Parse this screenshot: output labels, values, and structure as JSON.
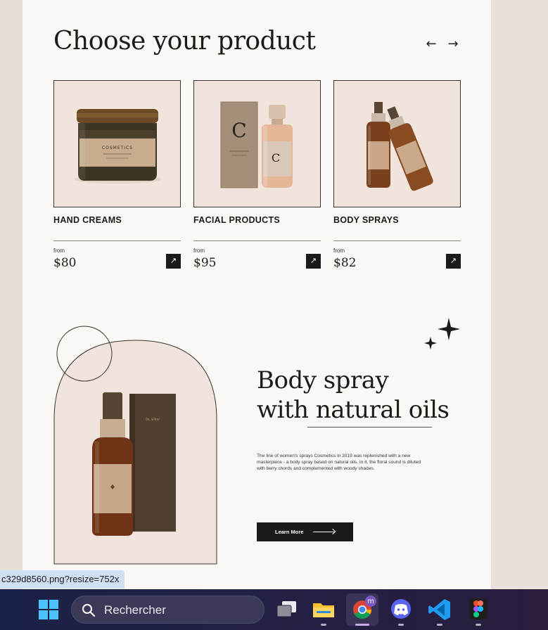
{
  "section": {
    "title": "Choose your product",
    "prev_icon": "←",
    "next_icon": "→"
  },
  "products": [
    {
      "name": "HAND CREAMS",
      "from": "from",
      "price": "$80",
      "icon": "arrow-up-right-icon"
    },
    {
      "name": "FACIAL PRODUCTS",
      "from": "from",
      "price": "$95",
      "icon": "arrow-up-right-icon"
    },
    {
      "name": "BODY SPRAYS",
      "from": "from",
      "price": "$82",
      "icon": "arrow-up-right-icon"
    }
  ],
  "feature": {
    "title": "Body spray\nwith natural oils",
    "text": "The line of women's sprays Cosmetics in 2019 was replenished with a new masterpiece - a body spray based on natural oils. In it, the floral sound is diluted with berry chords and complemented with woody shades.",
    "button_label": "Learn More"
  },
  "browser": {
    "status_url": "c329d8560.png?resize=752x"
  },
  "taskbar": {
    "search_placeholder": "Rechercher",
    "chrome_profile_badge": "m",
    "apps": [
      "start-icon",
      "search-icon",
      "task-view-icon",
      "file-explorer-icon",
      "chrome-icon",
      "discord-icon",
      "vscode-icon",
      "figma-icon"
    ]
  },
  "colors": {
    "page_bg": "#faf8f4",
    "card_bg": "#f1e4dc",
    "ink": "#1d1a17",
    "amber_glass": "#7a3f1c",
    "taskbar": "#1f2145"
  }
}
